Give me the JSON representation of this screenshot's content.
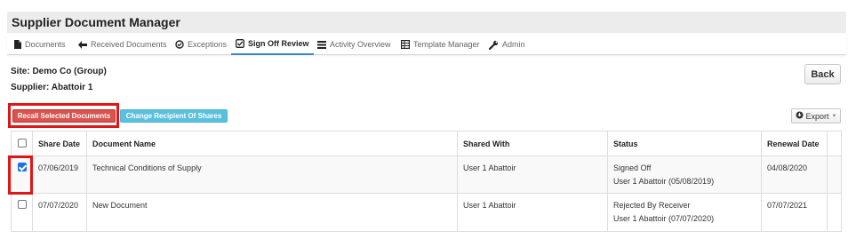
{
  "app": {
    "title": "Supplier Document Manager"
  },
  "nav": {
    "items": [
      {
        "label": "Documents",
        "icon": "file-icon"
      },
      {
        "label": "Received Documents",
        "icon": "arrow-left-icon"
      },
      {
        "label": "Exceptions",
        "icon": "check-circle-icon"
      },
      {
        "label": "Sign Off Review",
        "icon": "check-square-icon",
        "active": true
      },
      {
        "label": "Activity Overview",
        "icon": "list-icon"
      },
      {
        "label": "Template Manager",
        "icon": "table-icon"
      },
      {
        "label": "Admin",
        "icon": "wrench-icon"
      }
    ]
  },
  "context": {
    "site": "Site: Demo Co (Group)",
    "supplier": "Supplier: Abattoir 1"
  },
  "toolbar": {
    "back_label": "Back",
    "recall_label": "Recall Selected Documents",
    "change_label": "Change Recipient Of Shares",
    "export_label": "Export",
    "export_caret": "▼"
  },
  "table": {
    "headers": [
      "Share Date",
      "Document Name",
      "Shared With",
      "Status",
      "Renewal Date"
    ],
    "rows": [
      {
        "checked": true,
        "share_date": "07/06/2019",
        "document_name": "Technical Conditions of Supply",
        "shared_with": "User 1 Abattoir",
        "status": "Signed Off",
        "status_detail": "User 1 Abattoir (05/08/2019)",
        "renewal_date": "04/08/2020"
      },
      {
        "checked": false,
        "share_date": "07/07/2020",
        "document_name": "New Document",
        "shared_with": "User 1 Abattoir",
        "status": "Rejected By Receiver",
        "status_detail": "User 1 Abattoir (07/07/2020)",
        "renewal_date": "07/07/2021"
      }
    ]
  },
  "colors": {
    "highlight": "#e01616",
    "danger": "#d9534f",
    "info": "#5bc0de",
    "active_tab": "#3a87c8",
    "checkbox": "#1a73e8"
  }
}
